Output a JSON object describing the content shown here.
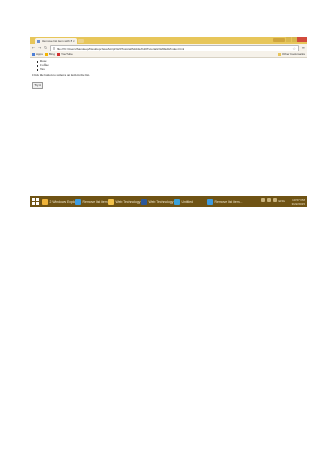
{
  "browser": {
    "tab_title": "Remove list item with Button",
    "tab_close": "×",
    "url": "file:///C:/Users/Sandeep/Desktop/JavaScript%20Tutorial/Mobile%20Tutorials%20Edit/Index.html",
    "back_icon": "arrow-left-icon",
    "forward_icon": "arrow-right-icon",
    "reload_icon": "reload-icon",
    "menu_icon": "hamburger-menu-icon"
  },
  "bookmarks": {
    "items": [
      "Apps",
      "Bing",
      "YouTube"
    ],
    "other": "Other bookmarks"
  },
  "page": {
    "list_items": [
      "Rose",
      "Coffee",
      "Tea"
    ],
    "instruction": "Click the button to remove an item in the list.",
    "button_label": "Try it"
  },
  "taskbar": {
    "items": [
      {
        "label": "2 Windows Explorer",
        "color": "#f0b43a"
      },
      {
        "label": "Remove list item w...",
        "color": "#3c9be0"
      },
      {
        "label": "Web Technology",
        "color": "#f2c14a"
      },
      {
        "label": "Web Technology",
        "color": "#2b579a"
      },
      {
        "label": "Untitled",
        "color": "#3aa0d8"
      },
      {
        "label": "Remove list item...",
        "color": "#3c9be0"
      }
    ],
    "lang": "ENG",
    "time": "10:57 PM",
    "date": "3/22/2015"
  },
  "colors": {
    "titlebar": "#e7c65a",
    "taskbar": "#6f5314",
    "close_button": "#d24b3c"
  }
}
